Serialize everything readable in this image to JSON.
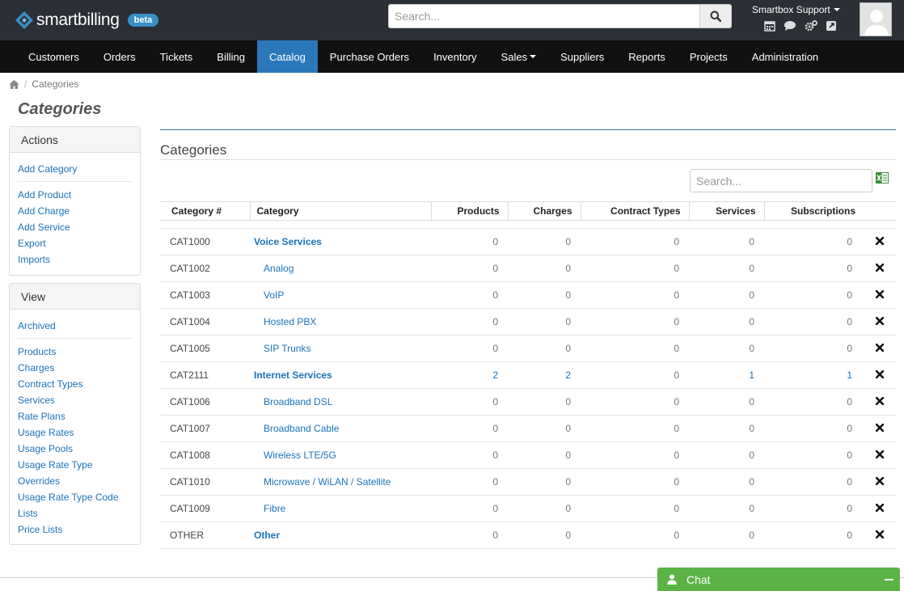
{
  "app": {
    "logo": "smartbilling",
    "badge": "beta"
  },
  "search": {
    "placeholder": "Search..."
  },
  "user": {
    "name": "Smartbox Support"
  },
  "nav": [
    "Customers",
    "Orders",
    "Tickets",
    "Billing",
    "Catalog",
    "Purchase Orders",
    "Inventory",
    "Sales",
    "Suppliers",
    "Reports",
    "Projects",
    "Administration"
  ],
  "nav_active": "Catalog",
  "breadcrumb": {
    "current": "Categories"
  },
  "page_title": "Categories",
  "actions": {
    "title": "Actions",
    "add_category": "Add Category",
    "links": [
      "Add Product",
      "Add Charge",
      "Add Service",
      "Export",
      "Imports"
    ]
  },
  "view": {
    "title": "View",
    "archived": "Archived",
    "links": [
      "Products",
      "Charges",
      "Contract Types",
      "Services",
      "Rate Plans",
      "Usage Rates",
      "Usage Pools",
      "Usage Rate Type",
      "Overrides",
      "Usage Rate Type Code",
      "Lists",
      "Price Lists"
    ]
  },
  "section_title": "Categories",
  "table_search": {
    "placeholder": "Search..."
  },
  "table": {
    "headers": [
      "Category #",
      "Category",
      "Products",
      "Charges",
      "Contract Types",
      "Services",
      "Subscriptions"
    ],
    "rows": [
      {
        "id": "CAT1000",
        "name": "Voice Services",
        "parent": true,
        "vals": [
          "0",
          "0",
          "0",
          "0",
          "0"
        ]
      },
      {
        "id": "CAT1002",
        "name": "Analog",
        "parent": false,
        "vals": [
          "0",
          "0",
          "0",
          "0",
          "0"
        ]
      },
      {
        "id": "CAT1003",
        "name": "VoIP",
        "parent": false,
        "vals": [
          "0",
          "0",
          "0",
          "0",
          "0"
        ]
      },
      {
        "id": "CAT1004",
        "name": "Hosted PBX",
        "parent": false,
        "vals": [
          "0",
          "0",
          "0",
          "0",
          "0"
        ]
      },
      {
        "id": "CAT1005",
        "name": "SIP Trunks",
        "parent": false,
        "vals": [
          "0",
          "0",
          "0",
          "0",
          "0"
        ]
      },
      {
        "id": "CAT2111",
        "name": "Internet Services",
        "parent": true,
        "vals": [
          "2",
          "2",
          "0",
          "1",
          "1"
        ]
      },
      {
        "id": "CAT1006",
        "name": "Broadband DSL",
        "parent": false,
        "vals": [
          "0",
          "0",
          "0",
          "0",
          "0"
        ]
      },
      {
        "id": "CAT1007",
        "name": "Broadband Cable",
        "parent": false,
        "vals": [
          "0",
          "0",
          "0",
          "0",
          "0"
        ]
      },
      {
        "id": "CAT1008",
        "name": "Wireless LTE/5G",
        "parent": false,
        "vals": [
          "0",
          "0",
          "0",
          "0",
          "0"
        ]
      },
      {
        "id": "CAT1010",
        "name": "Microwave / WiLAN / Satellite",
        "parent": false,
        "vals": [
          "0",
          "0",
          "0",
          "0",
          "0"
        ]
      },
      {
        "id": "CAT1009",
        "name": "Fibre",
        "parent": false,
        "vals": [
          "0",
          "0",
          "0",
          "0",
          "0"
        ]
      },
      {
        "id": "OTHER",
        "name": "Other",
        "parent": true,
        "vals": [
          "0",
          "0",
          "0",
          "0",
          "0"
        ]
      }
    ]
  },
  "chat": {
    "label": "Chat"
  },
  "colors": {
    "topbar": "#2b2f36",
    "nav": "#111111",
    "accent": "#2a77bb",
    "link": "#1a73b8",
    "chat": "#5cb345"
  }
}
